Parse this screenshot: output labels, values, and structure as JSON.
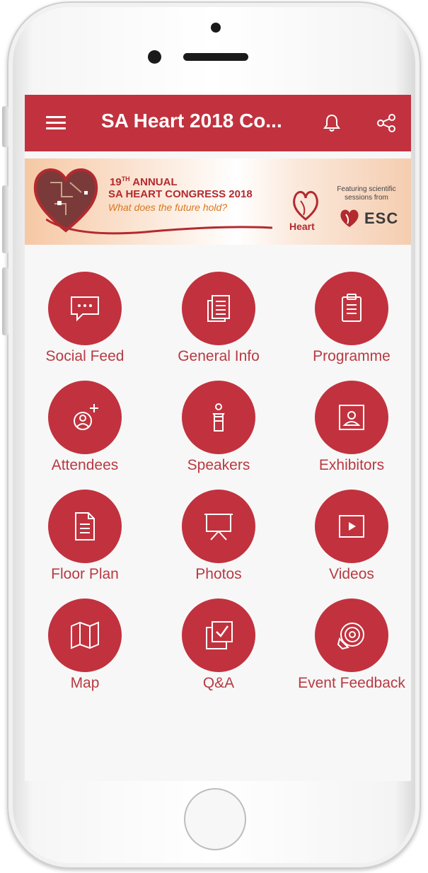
{
  "app": {
    "title": "SA Heart 2018 Co..."
  },
  "banner": {
    "annual_number": "19",
    "annual_suffix": "TH",
    "annual_word": " ANNUAL",
    "congress": "SA HEART CONGRESS 2018",
    "tagline": "What does the future hold?",
    "sa_heart_logo": "Heart",
    "featuring": "Featuring scientific sessions from",
    "esc": "ESC"
  },
  "tiles": [
    {
      "label": "Social Feed",
      "icon": "chat-bubble-icon"
    },
    {
      "label": "General Info",
      "icon": "document-icon"
    },
    {
      "label": "Programme",
      "icon": "clipboard-icon"
    },
    {
      "label": "Attendees",
      "icon": "add-person-icon"
    },
    {
      "label": "Speakers",
      "icon": "podium-icon"
    },
    {
      "label": "Exhibitors",
      "icon": "portrait-icon"
    },
    {
      "label": "Floor Plan",
      "icon": "file-icon"
    },
    {
      "label": "Photos",
      "icon": "projector-screen-icon"
    },
    {
      "label": "Videos",
      "icon": "play-icon"
    },
    {
      "label": "Map",
      "icon": "map-icon"
    },
    {
      "label": "Q&A",
      "icon": "checkbox-icon"
    },
    {
      "label": "Event Feedback",
      "icon": "feedback-icon"
    }
  ],
  "colors": {
    "primary": "#c1323e",
    "label": "#b83a42",
    "background": "#f7f7f7"
  }
}
